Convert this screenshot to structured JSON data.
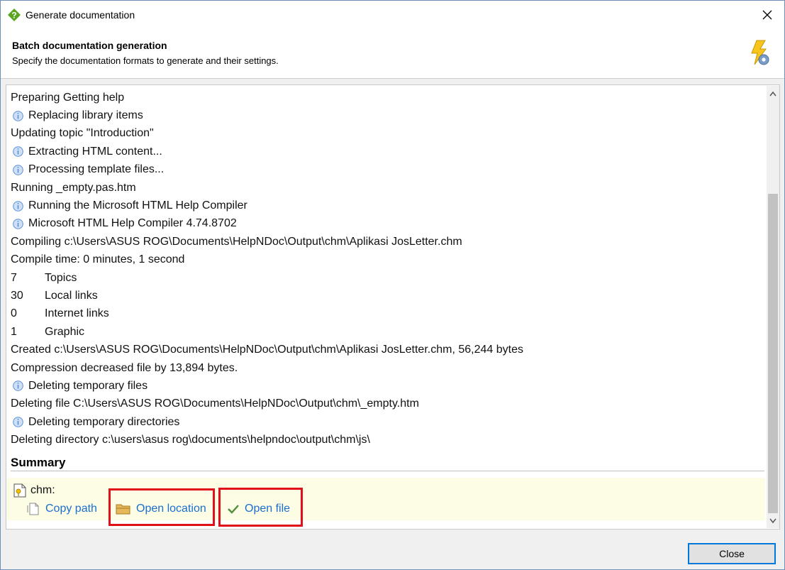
{
  "window": {
    "title": "Generate documentation"
  },
  "header": {
    "title": "Batch documentation generation",
    "subtitle": "Specify the documentation formats to generate and their settings."
  },
  "log": [
    {
      "text": "Preparing Getting help",
      "icon": ""
    },
    {
      "text": "Replacing library items",
      "icon": "info-icon"
    },
    {
      "text": "Updating topic \"Introduction\"",
      "icon": ""
    },
    {
      "text": "Extracting HTML content...",
      "icon": "info-icon"
    },
    {
      "text": "Processing template files...",
      "icon": "info-icon"
    },
    {
      "text": "Running _empty.pas.htm",
      "icon": ""
    },
    {
      "text": "Running the Microsoft HTML Help Compiler",
      "icon": "info-icon"
    },
    {
      "text": "Microsoft HTML Help Compiler 4.74.8702",
      "icon": "info-icon"
    },
    {
      "text": "Compiling c:\\Users\\ASUS ROG\\Documents\\HelpNDoc\\Output\\chm\\Aplikasi JosLetter.chm",
      "icon": ""
    },
    {
      "text": "Compile time: 0 minutes, 1 second",
      "icon": ""
    },
    {
      "num": "7",
      "text": "Topics",
      "icon": ""
    },
    {
      "num": "30",
      "text": "Local links",
      "icon": ""
    },
    {
      "num": "0",
      "text": "Internet links",
      "icon": ""
    },
    {
      "num": "1",
      "text": "Graphic",
      "icon": ""
    },
    {
      "text": "Created c:\\Users\\ASUS ROG\\Documents\\HelpNDoc\\Output\\chm\\Aplikasi JosLetter.chm, 56,244 bytes",
      "icon": ""
    },
    {
      "text": "Compression decreased file by 13,894 bytes.",
      "icon": ""
    },
    {
      "text": "Deleting temporary files",
      "icon": "info-icon"
    },
    {
      "text": "Deleting file C:\\Users\\ASUS ROG\\Documents\\HelpNDoc\\Output\\chm\\_empty.htm",
      "icon": ""
    },
    {
      "text": "Deleting temporary directories",
      "icon": "info-icon"
    },
    {
      "text": "Deleting directory c:\\users\\asus rog\\documents\\helpndoc\\output\\chm\\js\\",
      "icon": ""
    }
  ],
  "summary": {
    "title": "Summary",
    "format_label": "chm:",
    "copy_path": "Copy path",
    "open_location": "Open location",
    "open_file": "Open file"
  },
  "footer": {
    "close_label": "Close"
  },
  "colors": {
    "link": "#1a6fd1",
    "highlight": "#e0101a",
    "summary_bg": "#fdfde6",
    "info": "#5b8fd6"
  }
}
